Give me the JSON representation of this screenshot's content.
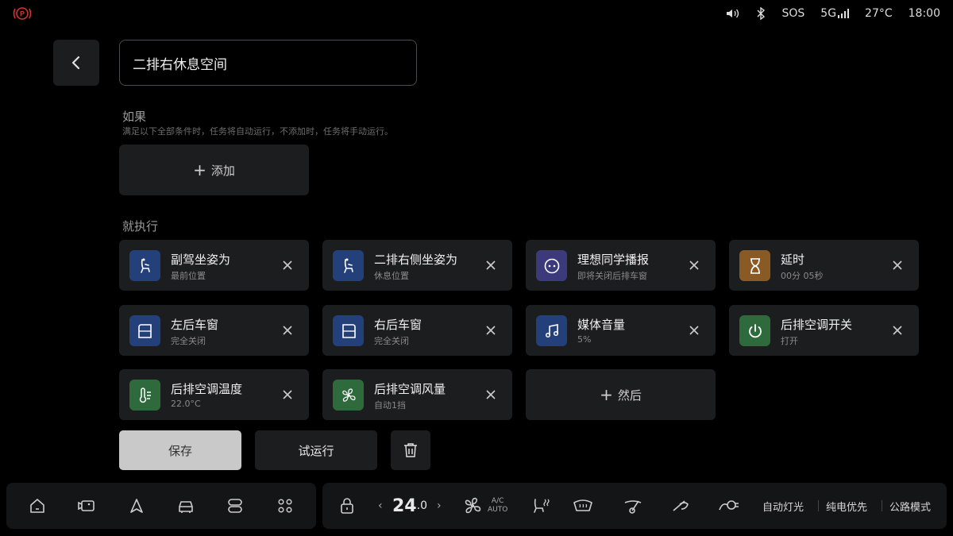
{
  "status": {
    "sos": "SOS",
    "network": "5G",
    "temperature": "27°C",
    "time": "18:00"
  },
  "header": {
    "task_name": "二排右休息空间"
  },
  "condition": {
    "label": "如果",
    "hint": "满足以下全部条件时，任务将自动运行，不添加时，任务将手动运行。",
    "add_label": "添加"
  },
  "actions": {
    "label": "就执行",
    "items": [
      {
        "title": "副驾坐姿为",
        "sub": "最前位置",
        "icon": "seat-icon",
        "color": "#24407a"
      },
      {
        "title": "二排右侧坐姿为",
        "sub": "休息位置",
        "icon": "seat-icon",
        "color": "#24407a"
      },
      {
        "title": "理想同学播报",
        "sub": "即将关闭后排车窗",
        "icon": "assistant-face-icon",
        "color": "#3c3a7a"
      },
      {
        "title": "延时",
        "sub": "00分 05秒",
        "icon": "hourglass-icon",
        "color": "#8a5a24"
      },
      {
        "title": "左后车窗",
        "sub": "完全关闭",
        "icon": "window-left-icon",
        "color": "#24407a"
      },
      {
        "title": "右后车窗",
        "sub": "完全关闭",
        "icon": "window-right-icon",
        "color": "#24407a"
      },
      {
        "title": "媒体音量",
        "sub": "5%",
        "icon": "music-note-icon",
        "color": "#24407a"
      },
      {
        "title": "后排空调开关",
        "sub": "打开",
        "icon": "power-icon",
        "color": "#2f6a3c"
      },
      {
        "title": "后排空调温度",
        "sub": "22.0°C",
        "icon": "thermometer-icon",
        "color": "#2f6a3c"
      },
      {
        "title": "后排空调风量",
        "sub": "自动1挡",
        "icon": "fan-icon",
        "color": "#2f6a3c"
      }
    ],
    "then_label": "然后"
  },
  "buttons": {
    "save": "保存",
    "test_run": "试运行"
  },
  "dock": {
    "temp_whole": "24",
    "temp_decimal": ".0",
    "ac_top": "A/C",
    "ac_bottom": "AUTO",
    "auto_light": "自动灯光",
    "ev_priority": "纯电优先",
    "road_mode": "公路模式"
  }
}
